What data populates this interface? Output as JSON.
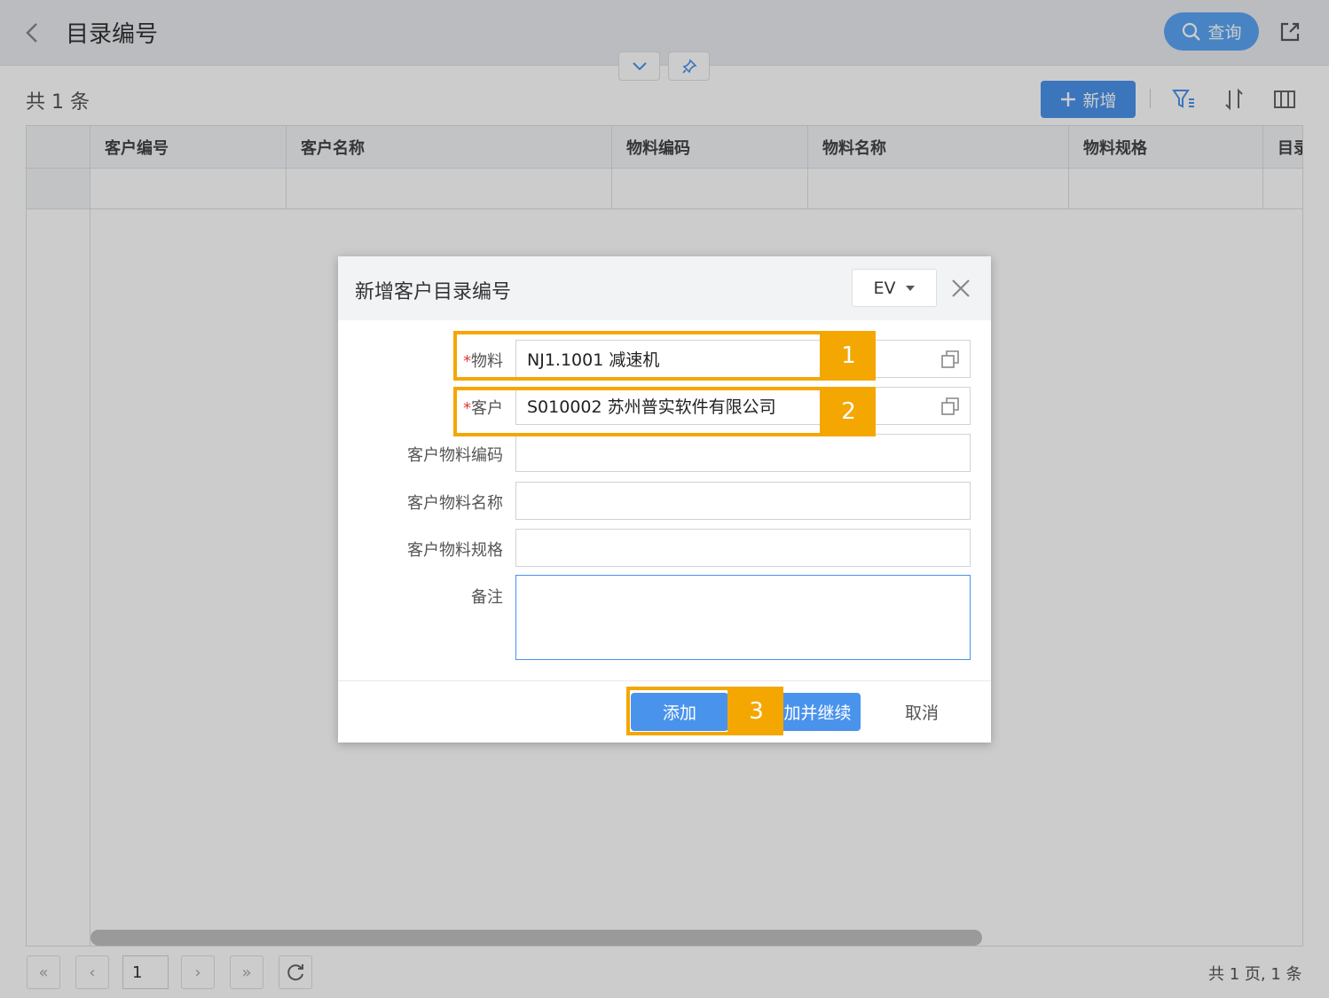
{
  "header": {
    "title": "目录编号",
    "query_label": "查询"
  },
  "toolbar": {
    "total_label": "共 1 条",
    "add_label": "新增"
  },
  "grid": {
    "columns": [
      "",
      "客户编号",
      "客户名称",
      "物料编码",
      "物料名称",
      "物料规格",
      "目录"
    ]
  },
  "pager": {
    "page_value": "1",
    "summary": "共 1 页, 1 条"
  },
  "dialog": {
    "title": "新增客户目录编号",
    "language": "EV",
    "fields": [
      {
        "label": "物料",
        "required": true,
        "value": "NJ1.1001 减速机"
      },
      {
        "label": "客户",
        "required": true,
        "value": "S010002 苏州普实软件有限公司"
      },
      {
        "label": "客户物料编码",
        "required": false,
        "value": ""
      },
      {
        "label": "客户物料名称",
        "required": false,
        "value": ""
      },
      {
        "label": "客户物料规格",
        "required": false,
        "value": ""
      },
      {
        "label": "备注",
        "required": false,
        "value": ""
      }
    ],
    "required_mark": "*",
    "add_button": "添加",
    "add_continue_button": "加并继续",
    "cancel_button": "取消"
  },
  "callouts": [
    "1",
    "2",
    "3"
  ],
  "colors": {
    "primary": "#4a93ec",
    "callout": "#f4a700",
    "required": "#e53935"
  }
}
